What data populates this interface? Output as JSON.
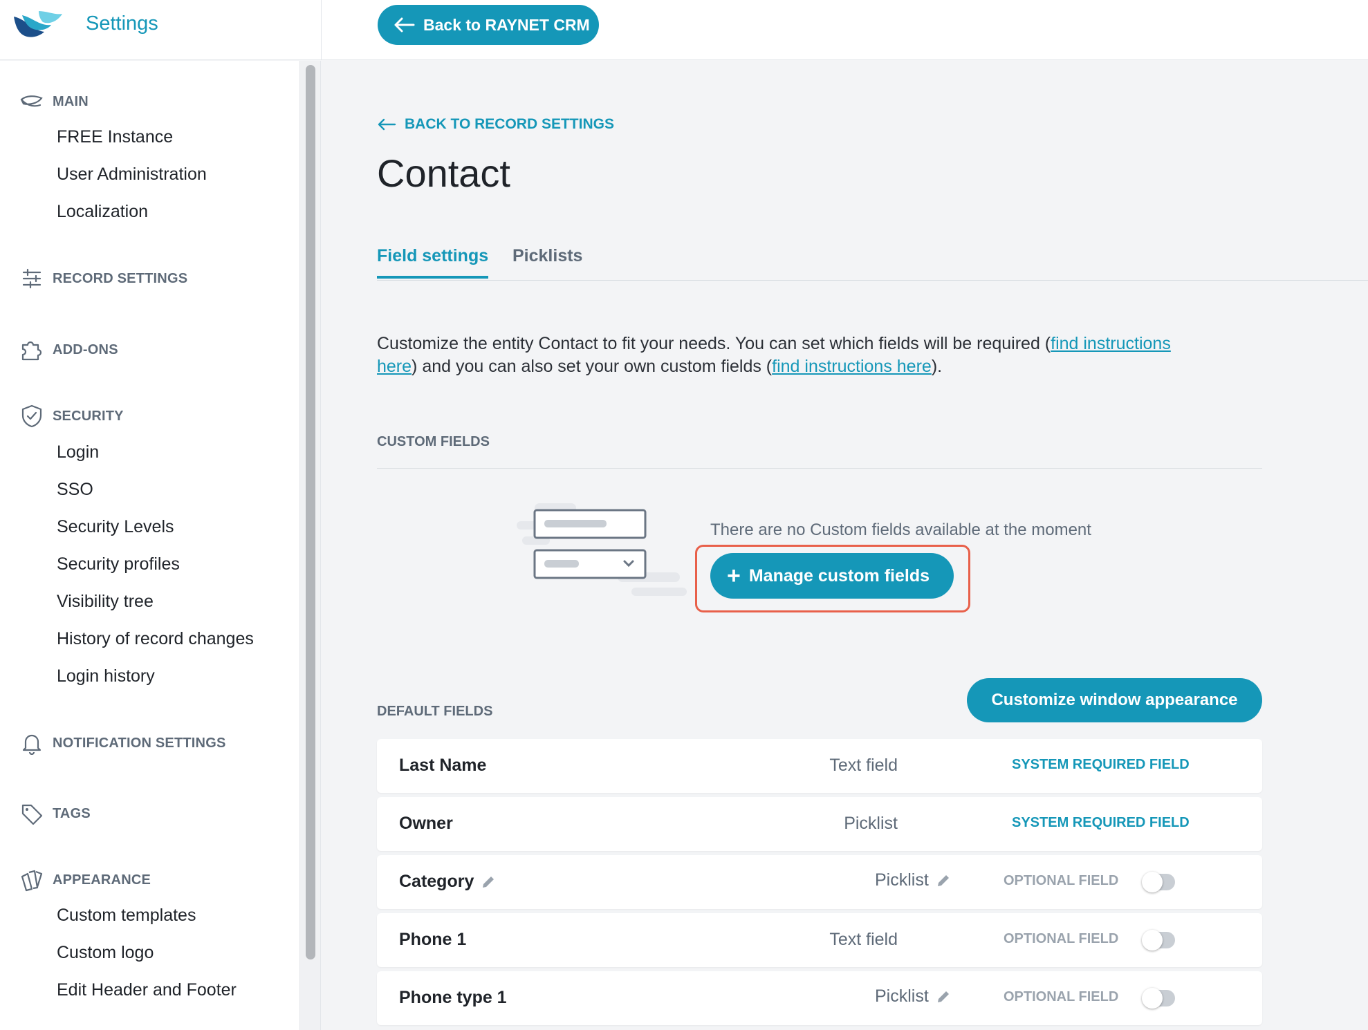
{
  "header": {
    "app_title": "Settings",
    "back_button_label": "Back to RAYNET CRM"
  },
  "sidebar": {
    "main": {
      "heading": "MAIN",
      "items": [
        "FREE Instance",
        "User Administration",
        "Localization"
      ]
    },
    "record_settings": {
      "heading": "RECORD SETTINGS"
    },
    "addons": {
      "heading": "ADD-ONS"
    },
    "security": {
      "heading": "SECURITY",
      "items": [
        "Login",
        "SSO",
        "Security Levels",
        "Security profiles",
        "Visibility tree",
        "History of record changes",
        "Login history"
      ]
    },
    "notification_settings": {
      "heading": "NOTIFICATION SETTINGS"
    },
    "tags": {
      "heading": "TAGS"
    },
    "appearance": {
      "heading": "APPEARANCE",
      "items": [
        "Custom templates",
        "Custom logo",
        "Edit Header and Footer"
      ]
    }
  },
  "main": {
    "back_link": "BACK TO RECORD SETTINGS",
    "title": "Contact",
    "tabs": [
      {
        "label": "Field settings",
        "active": true
      },
      {
        "label": "Picklists",
        "active": false
      }
    ],
    "description": {
      "part1": "Customize the entity Contact to fit your needs. You can set which fields will be required (",
      "link1": "find instructions here",
      "part2": ") and you can also set your own custom fields (",
      "link2": "find instructions here",
      "part3": ")."
    },
    "custom_fields": {
      "heading": "CUSTOM FIELDS",
      "empty_text": "There are no Custom fields available at the moment",
      "manage_button": "Manage custom fields"
    },
    "default_fields": {
      "heading": "DEFAULT FIELDS",
      "customize_button": "Customize window appearance",
      "rows": [
        {
          "name": "Last Name",
          "type": "Text field",
          "status": "SYSTEM REQUIRED FIELD"
        },
        {
          "name": "Owner",
          "type": "Picklist",
          "status": "SYSTEM REQUIRED FIELD"
        },
        {
          "name": "Category",
          "type": "Picklist",
          "status": "OPTIONAL FIELD"
        },
        {
          "name": "Phone 1",
          "type": "Text field",
          "status": "OPTIONAL FIELD"
        },
        {
          "name": "Phone type 1",
          "type": "Picklist",
          "status": "OPTIONAL FIELD"
        }
      ]
    }
  },
  "colors": {
    "accent": "#1597b8",
    "highlight_border": "#e8604a",
    "muted_text": "#5e6a78"
  }
}
